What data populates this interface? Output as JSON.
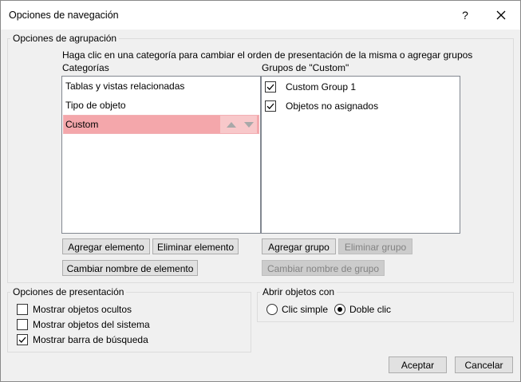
{
  "window": {
    "title": "Opciones de navegación",
    "help_label": "?"
  },
  "grouping": {
    "legend": "Opciones de agrupación",
    "instruction": "Haga clic en una categoría para cambiar el orden de presentación de la misma o agregar grupos",
    "categories_label": "Categorías",
    "categories": [
      {
        "label": "Tablas y vistas relacionadas",
        "selected": false
      },
      {
        "label": "Tipo de objeto",
        "selected": false
      },
      {
        "label": "Custom",
        "selected": true
      }
    ],
    "groups_label": "Grupos de \"Custom\"",
    "groups": [
      {
        "label": "Custom Group 1",
        "checked": true
      },
      {
        "label": "Objetos no asignados",
        "checked": true
      }
    ],
    "buttons": {
      "add_item": "Agregar elemento",
      "delete_item": "Eliminar elemento",
      "rename_item": "Cambiar nombre de elemento",
      "add_group": "Agregar grupo",
      "delete_group": "Eliminar grupo",
      "rename_group": "Cambiar nombre de grupo"
    }
  },
  "display": {
    "legend": "Opciones de presentación",
    "options": [
      {
        "label": "Mostrar objetos ocultos",
        "checked": false
      },
      {
        "label": "Mostrar objetos del sistema",
        "checked": false
      },
      {
        "label": "Mostrar barra de búsqueda",
        "checked": true
      }
    ]
  },
  "open_objects": {
    "legend": "Abrir objetos con",
    "options": [
      {
        "label": "Clic simple",
        "selected": false
      },
      {
        "label": "Doble clic",
        "selected": true
      }
    ]
  },
  "footer": {
    "ok": "Aceptar",
    "cancel": "Cancelar"
  },
  "colors": {
    "selection": "#f4a7ab",
    "dialog_bg": "#f0f0f0",
    "button_bg": "#e1e1e1"
  }
}
